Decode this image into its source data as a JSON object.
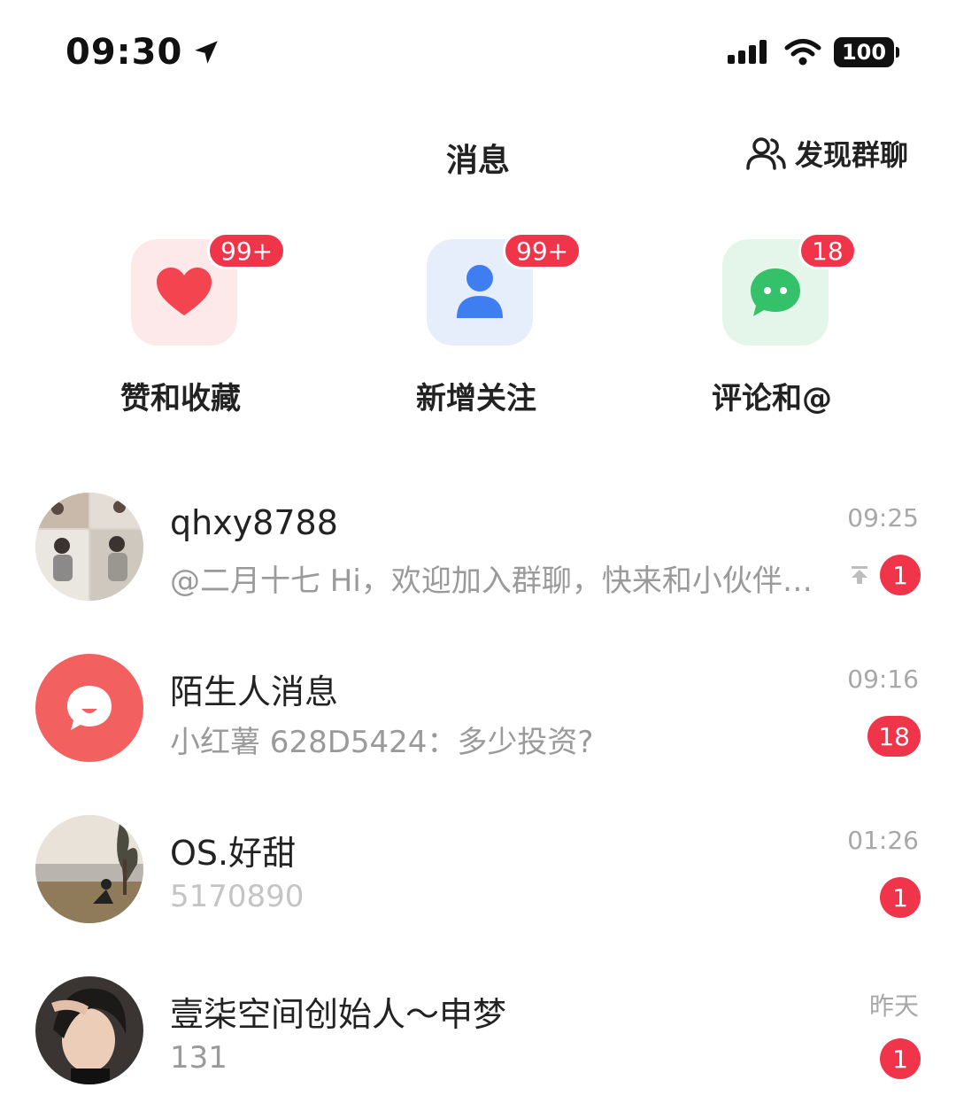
{
  "status_bar": {
    "time": "09:30",
    "battery": "100"
  },
  "header": {
    "title": "消息",
    "discover_label": "发现群聊"
  },
  "shortcuts": [
    {
      "label": "赞和收藏",
      "badge": "99+",
      "icon": "heart-icon",
      "color": "#f4444f"
    },
    {
      "label": "新增关注",
      "badge": "99+",
      "icon": "person-icon",
      "color": "#3f7ef0"
    },
    {
      "label": "评论和@",
      "badge": "18",
      "icon": "chat-bubble-icon",
      "color": "#35c16a"
    }
  ],
  "chats": [
    {
      "name": "qhxy8788",
      "preview": "@二月十七 Hi，欢迎加入群聊，快来和小伙伴们打个招呼吧",
      "time": "09:25",
      "badge": "1",
      "pinned": true
    },
    {
      "name": "陌生人消息",
      "preview": "小红薯 628D5424：多少投资?",
      "time": "09:16",
      "badge": "18"
    },
    {
      "name": "OS.好甜",
      "preview": "5170890",
      "time": "01:26",
      "badge": "1"
    },
    {
      "name": "壹柒空间创始人～申梦",
      "preview": "131",
      "time": "昨天",
      "badge": "1"
    }
  ],
  "colors": {
    "badge": "#f0354a",
    "stranger_avatar": "#f26060"
  }
}
